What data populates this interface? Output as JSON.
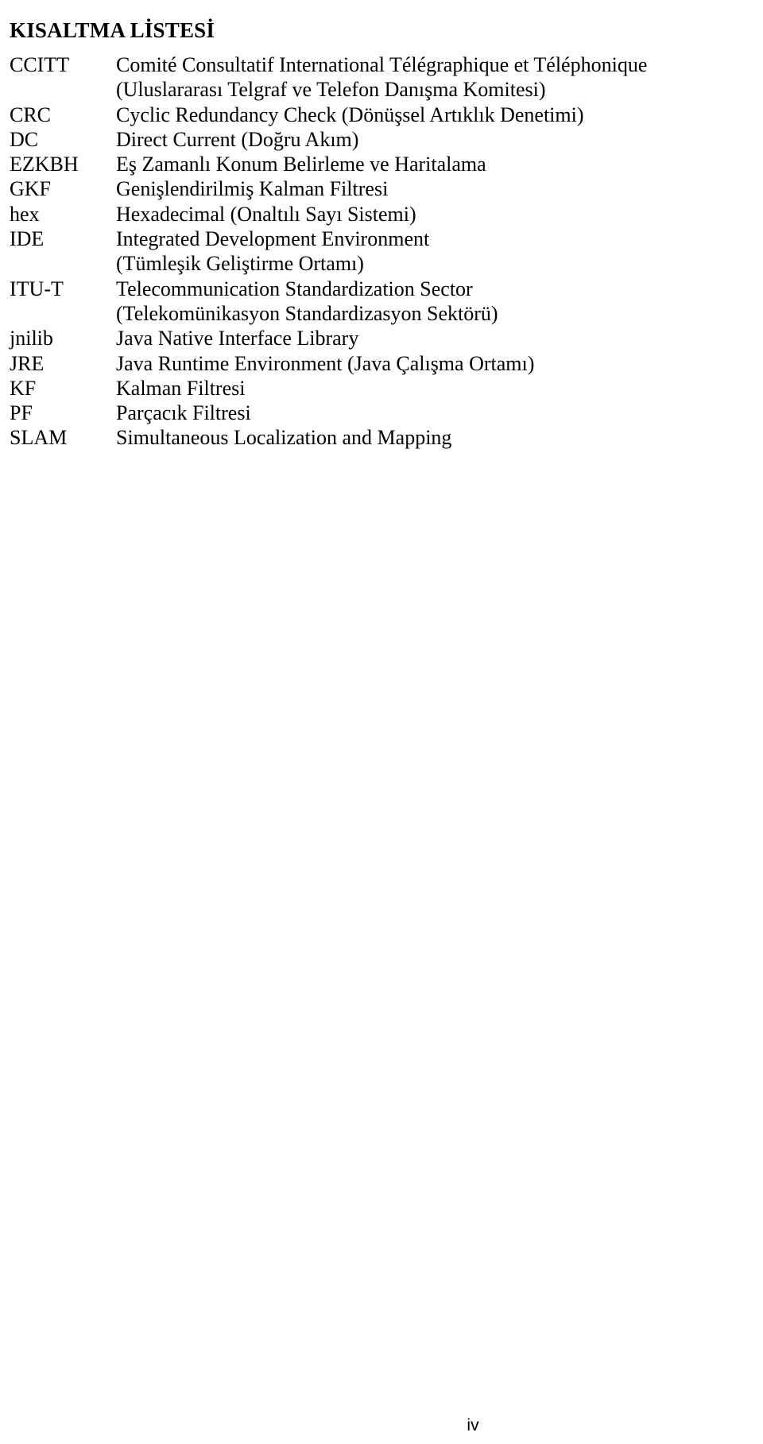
{
  "document": {
    "title": "KISALTMA LİSTESİ",
    "page_number": "iv",
    "entries": [
      {
        "term": "CCITT",
        "lines": [
          "Comité Consultatif International Télégraphique et Téléphonique",
          "(Uluslararası Telgraf ve Telefon Danışma Komitesi)"
        ]
      },
      {
        "term": "CRC",
        "lines": [
          "Cyclic Redundancy Check (Dönüşsel Artıklık Denetimi)"
        ]
      },
      {
        "term": "DC",
        "lines": [
          "Direct Current (Doğru Akım)"
        ]
      },
      {
        "term": "EZKBH",
        "lines": [
          "Eş Zamanlı Konum Belirleme ve Haritalama"
        ]
      },
      {
        "term": "GKF",
        "lines": [
          "Genişlendirilmiş Kalman Filtresi"
        ]
      },
      {
        "term": "hex",
        "lines": [
          "Hexadecimal (Onaltılı Sayı Sistemi)"
        ]
      },
      {
        "term": "IDE",
        "lines": [
          "Integrated Development Environment",
          "(Tümleşik Geliştirme Ortamı)"
        ]
      },
      {
        "term": "ITU-T",
        "lines": [
          "Telecommunication Standardization Sector",
          "(Telekomünikasyon Standardizasyon Sektörü)"
        ]
      },
      {
        "term": "jnilib",
        "lines": [
          "Java Native Interface Library"
        ]
      },
      {
        "term": "JRE",
        "lines": [
          "Java Runtime Environment (Java Çalışma Ortamı)"
        ]
      },
      {
        "term": "KF",
        "lines": [
          "Kalman Filtresi"
        ]
      },
      {
        "term": "PF",
        "lines": [
          "Parçacık Filtresi"
        ]
      },
      {
        "term": "SLAM",
        "lines": [
          "Simultaneous Localization and Mapping"
        ]
      }
    ]
  }
}
